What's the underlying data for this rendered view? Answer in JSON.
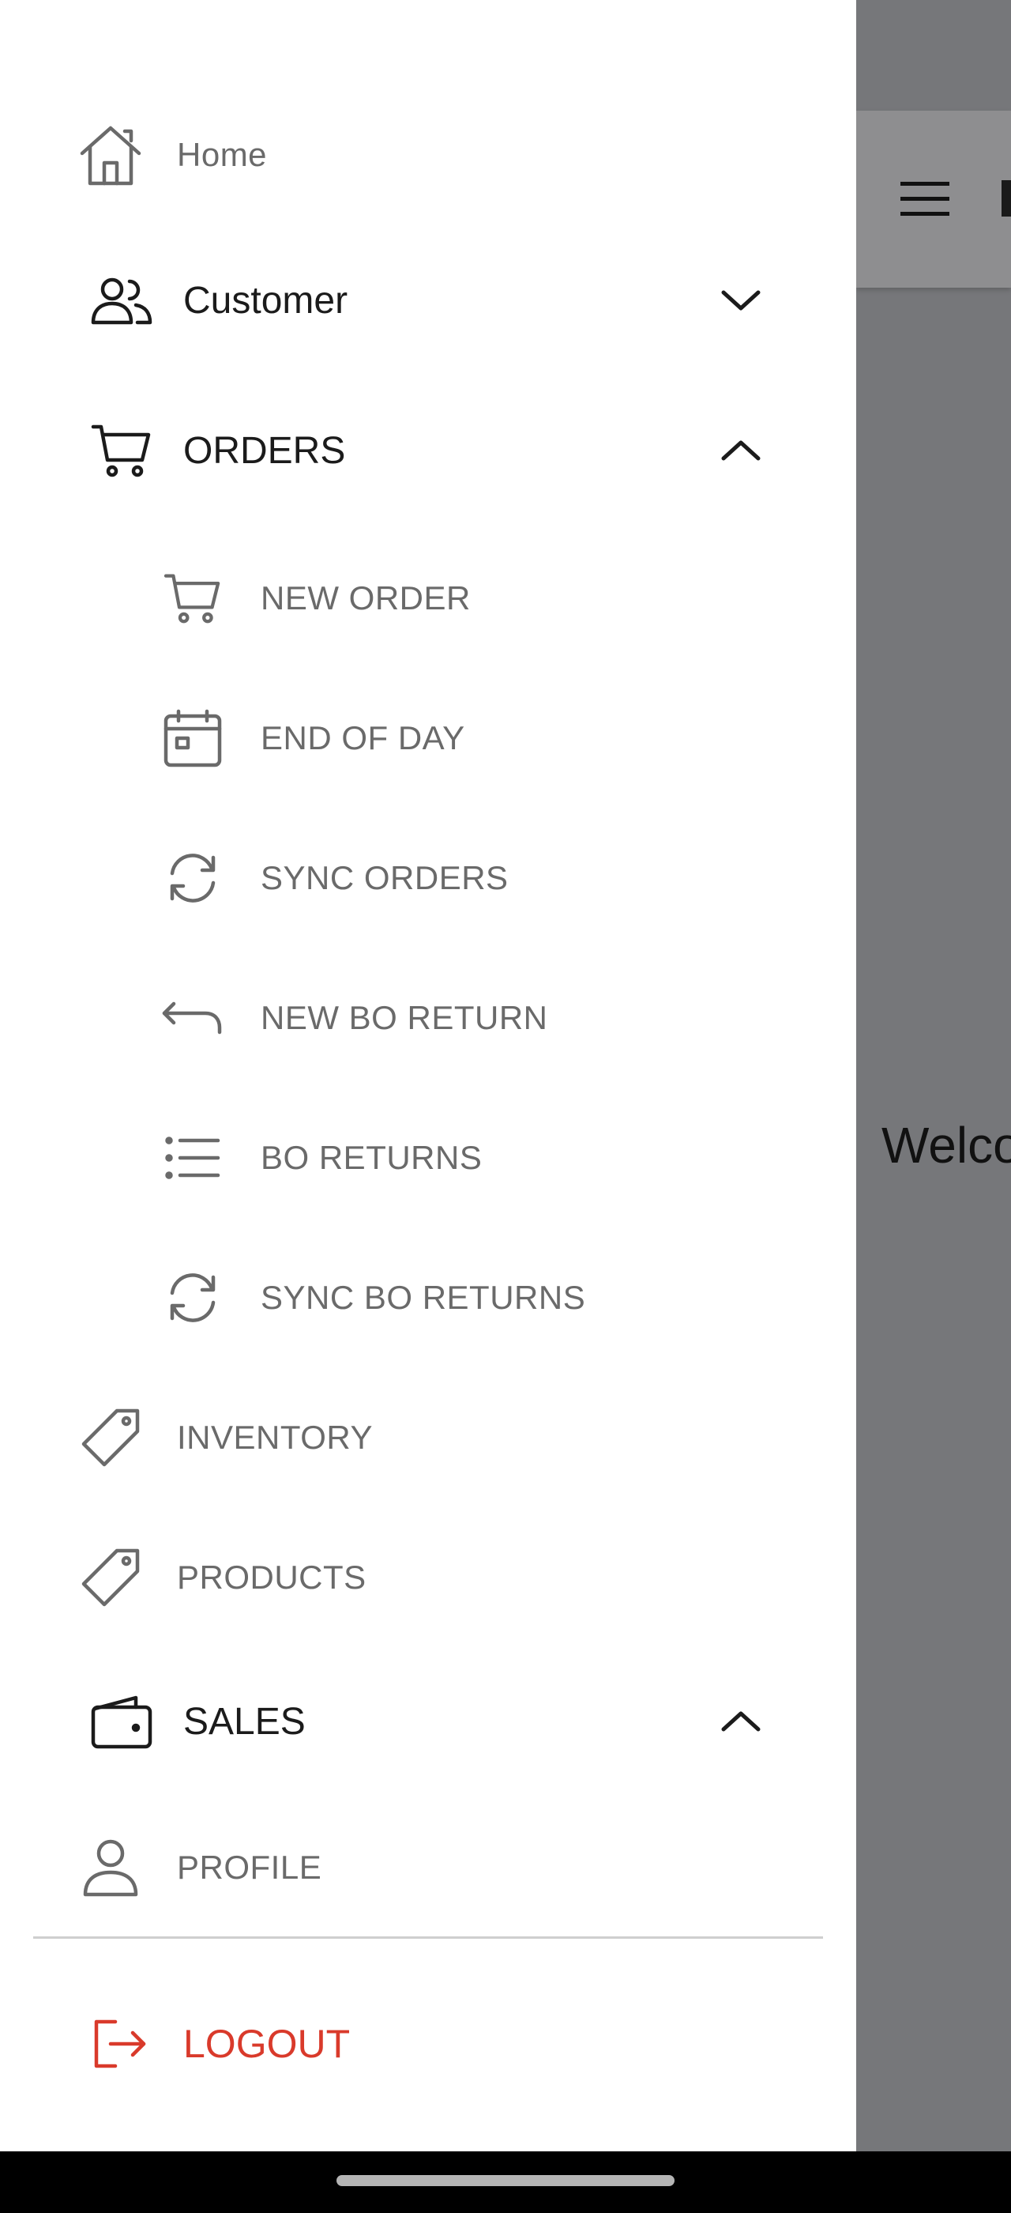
{
  "drawer": {
    "home": {
      "label": "Home",
      "icon": "home-icon"
    },
    "customer": {
      "label": "Customer",
      "icon": "people-icon",
      "expanded": false
    },
    "orders": {
      "label": "ORDERS",
      "icon": "cart-icon",
      "expanded": true,
      "items": [
        {
          "label": "NEW ORDER",
          "icon": "cart-icon"
        },
        {
          "label": "END OF DAY",
          "icon": "calendar-icon"
        },
        {
          "label": "SYNC ORDERS",
          "icon": "sync-icon"
        },
        {
          "label": "NEW BO RETURN",
          "icon": "return-arrow-icon"
        },
        {
          "label": "BO RETURNS",
          "icon": "list-icon"
        },
        {
          "label": "SYNC BO RETURNS",
          "icon": "sync-icon"
        }
      ]
    },
    "inventory": {
      "label": "INVENTORY",
      "icon": "tag-icon"
    },
    "products": {
      "label": "PRODUCTS",
      "icon": "tag-icon"
    },
    "sales": {
      "label": "SALES",
      "icon": "wallet-icon",
      "expanded": true
    },
    "profile": {
      "label": "PROFILE",
      "icon": "person-icon"
    },
    "logout": {
      "label": "LOGOUT",
      "icon": "logout-icon"
    }
  },
  "background": {
    "welcome_text": "Welco"
  },
  "colors": {
    "drawer_bg": "#ffffff",
    "scrim": "#76777a",
    "text_primary": "#1b1b1b",
    "text_secondary": "#6a6a6a",
    "logout_red": "#d93a2b",
    "nav_bar": "#000000"
  }
}
